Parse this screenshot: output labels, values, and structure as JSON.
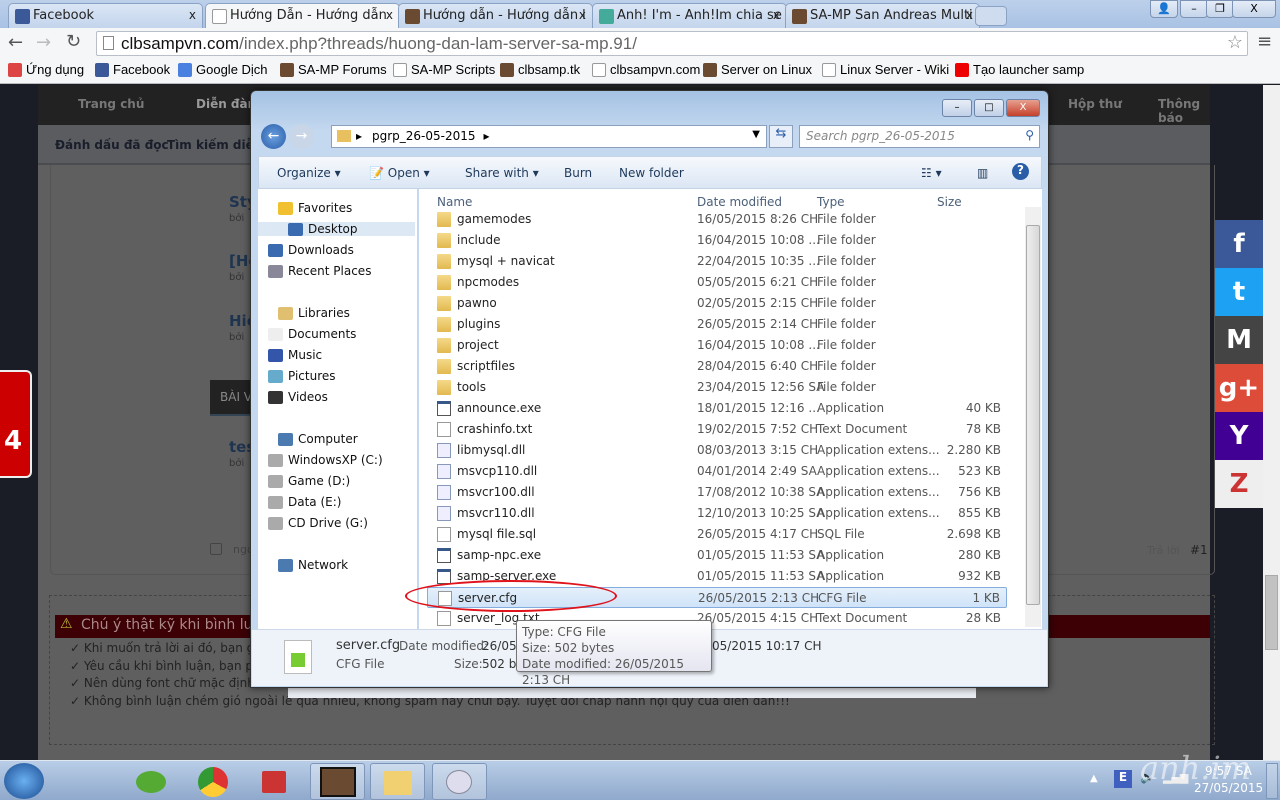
{
  "browser": {
    "tabs": [
      {
        "label": "Facebook",
        "icon": "facebook-icon"
      },
      {
        "label": "Hướng Dẫn - Hướng dẫn",
        "icon": "page-icon",
        "active": true
      },
      {
        "label": "Hướng dẫn - Hướng dẫn l",
        "icon": "samp-icon"
      },
      {
        "label": "Anh! I'm - Anh!Im chia se",
        "icon": "cloud-icon"
      },
      {
        "label": "SA-MP San Andreas Multi",
        "icon": "samp-icon"
      }
    ],
    "url_domain": "clbsampvn.com",
    "url_path": "/index.php?threads/huong-dan-lam-server-sa-mp.91/",
    "bookmarks": [
      "Ứng dụng",
      "Facebook",
      "Google Dịch",
      "SA-MP Forums",
      "SA-MP Scripts",
      "clbsamp.tk",
      "clbsampvn.com",
      "Server on  Linux",
      "Linux Server - Wiki",
      "Tạo launcher samp"
    ]
  },
  "forum": {
    "nav": [
      "Trang chủ",
      "Diễn đàn",
      "Hộp thư",
      "Thông báo"
    ],
    "subnav": [
      "Đánh dấu đã đọc",
      "Tìm kiếm diễn"
    ],
    "posts": [
      "Sty",
      "[He",
      "Hiệ",
      "tes"
    ],
    "by": "bởi",
    "section": "BÀI V",
    "reply": "Trả lời",
    "post_no": "#1",
    "checkbox_label": "ngo",
    "badge_count": "4",
    "notice_title": "Chú ý thật kỹ khi bình luận:",
    "rules": [
      "Khi muốn trả lời ai đó, bạn gõ @",
      "Yêu cầu khi bình luận, bạn phải",
      "Nên dùng font chữ mặc định của diễn",
      "Không bình luận chém gió ngoài lề quá nhiều, không spam hay chửi bậy. Tuyệt đối chấp hành nội quy của diễn đàn!!!"
    ],
    "social": [
      {
        "label": "f",
        "color": "#3b5998"
      },
      {
        "label": "t",
        "color": "#1da1f2"
      },
      {
        "label": "M",
        "color": "#444"
      },
      {
        "label": "g+",
        "color": "#dd4b39"
      },
      {
        "label": "Y",
        "color": "#410093"
      },
      {
        "label": "Z",
        "color": "#eee"
      }
    ]
  },
  "explorer": {
    "breadcrumb": "pgrp_26-05-2015",
    "search_placeholder": "Search pgrp_26-05-2015",
    "toolbar": [
      "Organize",
      "Open",
      "Share with",
      "Burn",
      "New folder"
    ],
    "nav": {
      "favorites": "Favorites",
      "fav_items": [
        "Desktop",
        "Downloads",
        "Recent Places"
      ],
      "libraries": "Libraries",
      "lib_items": [
        "Documents",
        "Music",
        "Pictures",
        "Videos"
      ],
      "computer": "Computer",
      "drives": [
        "WindowsXP (C:)",
        "Game (D:)",
        "Data (E:)",
        "CD Drive (G:)"
      ],
      "network": "Network"
    },
    "columns": [
      "Name",
      "Date modified",
      "Type",
      "Size"
    ],
    "files": [
      {
        "name": "gamemodes",
        "date": "16/05/2015 8:26 CH",
        "type": "File folder",
        "size": "",
        "kind": "folder"
      },
      {
        "name": "include",
        "date": "16/04/2015 10:08 ...",
        "type": "File folder",
        "size": "",
        "kind": "folder"
      },
      {
        "name": "mysql + navicat",
        "date": "22/04/2015 10:35 ...",
        "type": "File folder",
        "size": "",
        "kind": "folder"
      },
      {
        "name": "npcmodes",
        "date": "05/05/2015 6:21 CH",
        "type": "File folder",
        "size": "",
        "kind": "folder"
      },
      {
        "name": "pawno",
        "date": "02/05/2015 2:15 CH",
        "type": "File folder",
        "size": "",
        "kind": "folder"
      },
      {
        "name": "plugins",
        "date": "26/05/2015 2:14 CH",
        "type": "File folder",
        "size": "",
        "kind": "folder"
      },
      {
        "name": "project",
        "date": "16/04/2015 10:08 ...",
        "type": "File folder",
        "size": "",
        "kind": "folder"
      },
      {
        "name": "scriptfiles",
        "date": "28/04/2015 6:40 CH",
        "type": "File folder",
        "size": "",
        "kind": "folder"
      },
      {
        "name": "tools",
        "date": "23/04/2015 12:56 SA",
        "type": "File folder",
        "size": "",
        "kind": "folder"
      },
      {
        "name": "announce.exe",
        "date": "18/01/2015 12:16 ...",
        "type": "Application",
        "size": "40 KB",
        "kind": "app"
      },
      {
        "name": "crashinfo.txt",
        "date": "19/02/2015 7:52 CH",
        "type": "Text Document",
        "size": "78 KB",
        "kind": "doc"
      },
      {
        "name": "libmysql.dll",
        "date": "08/03/2013 3:15 CH",
        "type": "Application extens...",
        "size": "2.280 KB",
        "kind": "dll"
      },
      {
        "name": "msvcp110.dll",
        "date": "04/01/2014 2:49 SA",
        "type": "Application extens...",
        "size": "523 KB",
        "kind": "dll"
      },
      {
        "name": "msvcr100.dll",
        "date": "17/08/2012 10:38 SA",
        "type": "Application extens...",
        "size": "756 KB",
        "kind": "dll"
      },
      {
        "name": "msvcr110.dll",
        "date": "12/10/2013 10:25 SA",
        "type": "Application extens...",
        "size": "855 KB",
        "kind": "dll"
      },
      {
        "name": "mysql file.sql",
        "date": "26/05/2015 4:17 CH",
        "type": "SQL File",
        "size": "2.698 KB",
        "kind": "doc"
      },
      {
        "name": "samp-npc.exe",
        "date": "01/05/2015 11:53 SA",
        "type": "Application",
        "size": "280 KB",
        "kind": "app"
      },
      {
        "name": "samp-server.exe",
        "date": "01/05/2015 11:53 SA",
        "type": "Application",
        "size": "932 KB",
        "kind": "app"
      },
      {
        "name": "server.cfg",
        "date": "26/05/2015 2:13 CH",
        "type": "CFG File",
        "size": "1 KB",
        "kind": "doc",
        "selected": true
      },
      {
        "name": "server_log.txt",
        "date": "26/05/2015 4:15 CH",
        "type": "Text Document",
        "size": "28 KB",
        "kind": "doc"
      }
    ],
    "details": {
      "name": "server.cfg",
      "type": "CFG File",
      "date_label": "Date modified:",
      "date_value": "26/05/",
      "date_tail": "05/2015 10:17 CH",
      "size_label": "Size:",
      "size_value": "502 by"
    },
    "tooltip": [
      "Type: CFG File",
      "Size: 502 bytes",
      "Date modified: 26/05/2015 2:13 CH"
    ]
  },
  "taskbar": {
    "time": "9:57 SA",
    "date": "27/05/2015",
    "watermark": "anh.im"
  }
}
